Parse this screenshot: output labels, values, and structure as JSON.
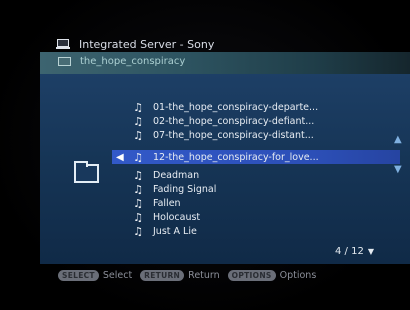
{
  "header": {
    "server_label": "Integrated Server - Sony",
    "folder_label": "the_hope_conspiracy"
  },
  "tracks": [
    {
      "label": "01-the_hope_conspiracy-departe..."
    },
    {
      "label": "02-the_hope_conspiracy-defiant..."
    },
    {
      "label": "07-the_hope_conspiracy-distant..."
    },
    {
      "label": "12-the_hope_conspiracy-for_love..."
    },
    {
      "label": "Deadman"
    },
    {
      "label": "Fading Signal"
    },
    {
      "label": "Fallen"
    },
    {
      "label": "Holocaust"
    },
    {
      "label": "Just A Lie"
    }
  ],
  "selected_index": 3,
  "pager": "4 / 12",
  "footer": {
    "select_key": "SELECT",
    "select_label": "Select",
    "return_key": "RETURN",
    "return_label": "Return",
    "options_key": "OPTIONS",
    "options_label": "Options"
  },
  "icons": {
    "server": "computer-icon",
    "folder": "folder-icon",
    "track": "music-note-icon"
  },
  "colors": {
    "panel": "#163556",
    "selection": "#2c4fb7",
    "header_bar": "#2d5360"
  }
}
